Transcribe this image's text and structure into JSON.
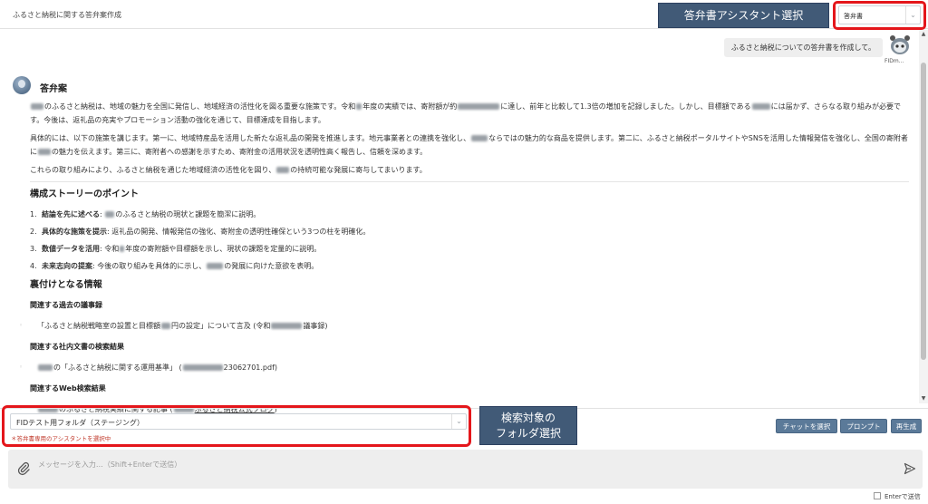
{
  "header": {
    "title": "ふるさと納税に関する答弁案作成",
    "assistant_callout": "答弁書アシスタント選択",
    "assistant_select_value": "答弁書"
  },
  "user_message": {
    "text": "ふるさと納税についての答弁書を作成して。",
    "user_name": "FIDm..."
  },
  "bot_message": {
    "name": "答弁案",
    "para1": {
      "a": "のふるさと納税は、地域の魅力を全国に発信し、地域経済の活性化を図る重要な施策です。令和",
      "b": "年度の実績では、寄附額が約",
      "c": "に達し、前年と比較して1.3倍の増加を記録しました。しかし、目標額である",
      "d": "には届かず、さらなる取り組みが必要です。今後は、返礼品の充実やプロモーション活動の強化を通じて、目標達成を目指します。"
    },
    "para2": {
      "a": "具体的には、以下の施策を講じます。第一に、地域特産品を活用した新たな返礼品の開発を推進します。地元事業者との連携を強化し、",
      "b": "ならではの魅力的な商品を提供します。第二に、ふるさと納税ポータルサイトやSNSを活用した情報発信を強化し、全国の寄附者に",
      "c": "の魅力を伝えます。第三に、寄附者への感謝を示すため、寄附金の活用状況を透明性高く報告し、信頼を深めます。"
    },
    "para3": {
      "a": "これらの取り組みにより、ふるさと納税を通じた地域経済の活性化を図り、",
      "b": "の持続可能な発展に寄与してまいります。"
    }
  },
  "story": {
    "heading": "構成ストーリーのポイント",
    "items": [
      {
        "num": "1.",
        "title": "結論を先に述べる",
        "text_a": ": ",
        "text_b": "のふるさと納税の現状と課題を簡潔に説明。"
      },
      {
        "num": "2.",
        "title": "具体的な施策を提示",
        "text_a": ": 返礼品の開発、情報発信の強化、寄附金の透明性確保という3つの柱を明確化。",
        "text_b": ""
      },
      {
        "num": "3.",
        "title": "数値データを活用",
        "text_a": ": 令和",
        "text_b": "年度の寄附額や目標額を示し、現状の課題を定量的に説明。"
      },
      {
        "num": "4.",
        "title": "未来志向の提案",
        "text_a": ": 今後の取り組みを具体的に示し、",
        "text_b": "の発展に向けた意欲を表明。"
      }
    ]
  },
  "support": {
    "heading": "裏付けとなる情報",
    "minutes_heading": "関連する過去の議事録",
    "minutes_a": "「ふるさと納税戦略室の設置と目標額",
    "minutes_b": "円の設定」について言及 (令和",
    "minutes_c": "議事録)",
    "docs_heading": "関連する社内文書の検索結果",
    "docs_a": "の「ふるさと納税に関する運用基準」 (",
    "docs_b": "23062701.pdf)",
    "web_heading": "関連するWeb検索結果",
    "web_a": "のふるさと納税実績に関する記事 (",
    "web_link": "ふるさと納税公式ブログ",
    "web_b": ")"
  },
  "bottom": {
    "folder_value": "FIDテスト用フォルダ（ステージング）",
    "folder_hint": "＊答弁書専用のアシスタントを選択中",
    "folder_callout_line1": "検索対象の",
    "folder_callout_line2": "フォルダ選択",
    "btn_chat": "チャットを選択",
    "btn_prompt": "プロンプト",
    "btn_regen": "再生成",
    "input_placeholder": "メッセージを入力…（Shift+Enterで送信）",
    "enter_label": "Enterで送信"
  },
  "colors": {
    "callout_bg": "#415a77",
    "highlight_frame": "#e4161b",
    "button_bg": "#5b7a99",
    "hint_text": "#c0392b"
  },
  "icons": [
    "paperclip-icon",
    "send-icon",
    "chevron-down-icon",
    "robot-avatar-icon",
    "bot-avatar-icon"
  ]
}
